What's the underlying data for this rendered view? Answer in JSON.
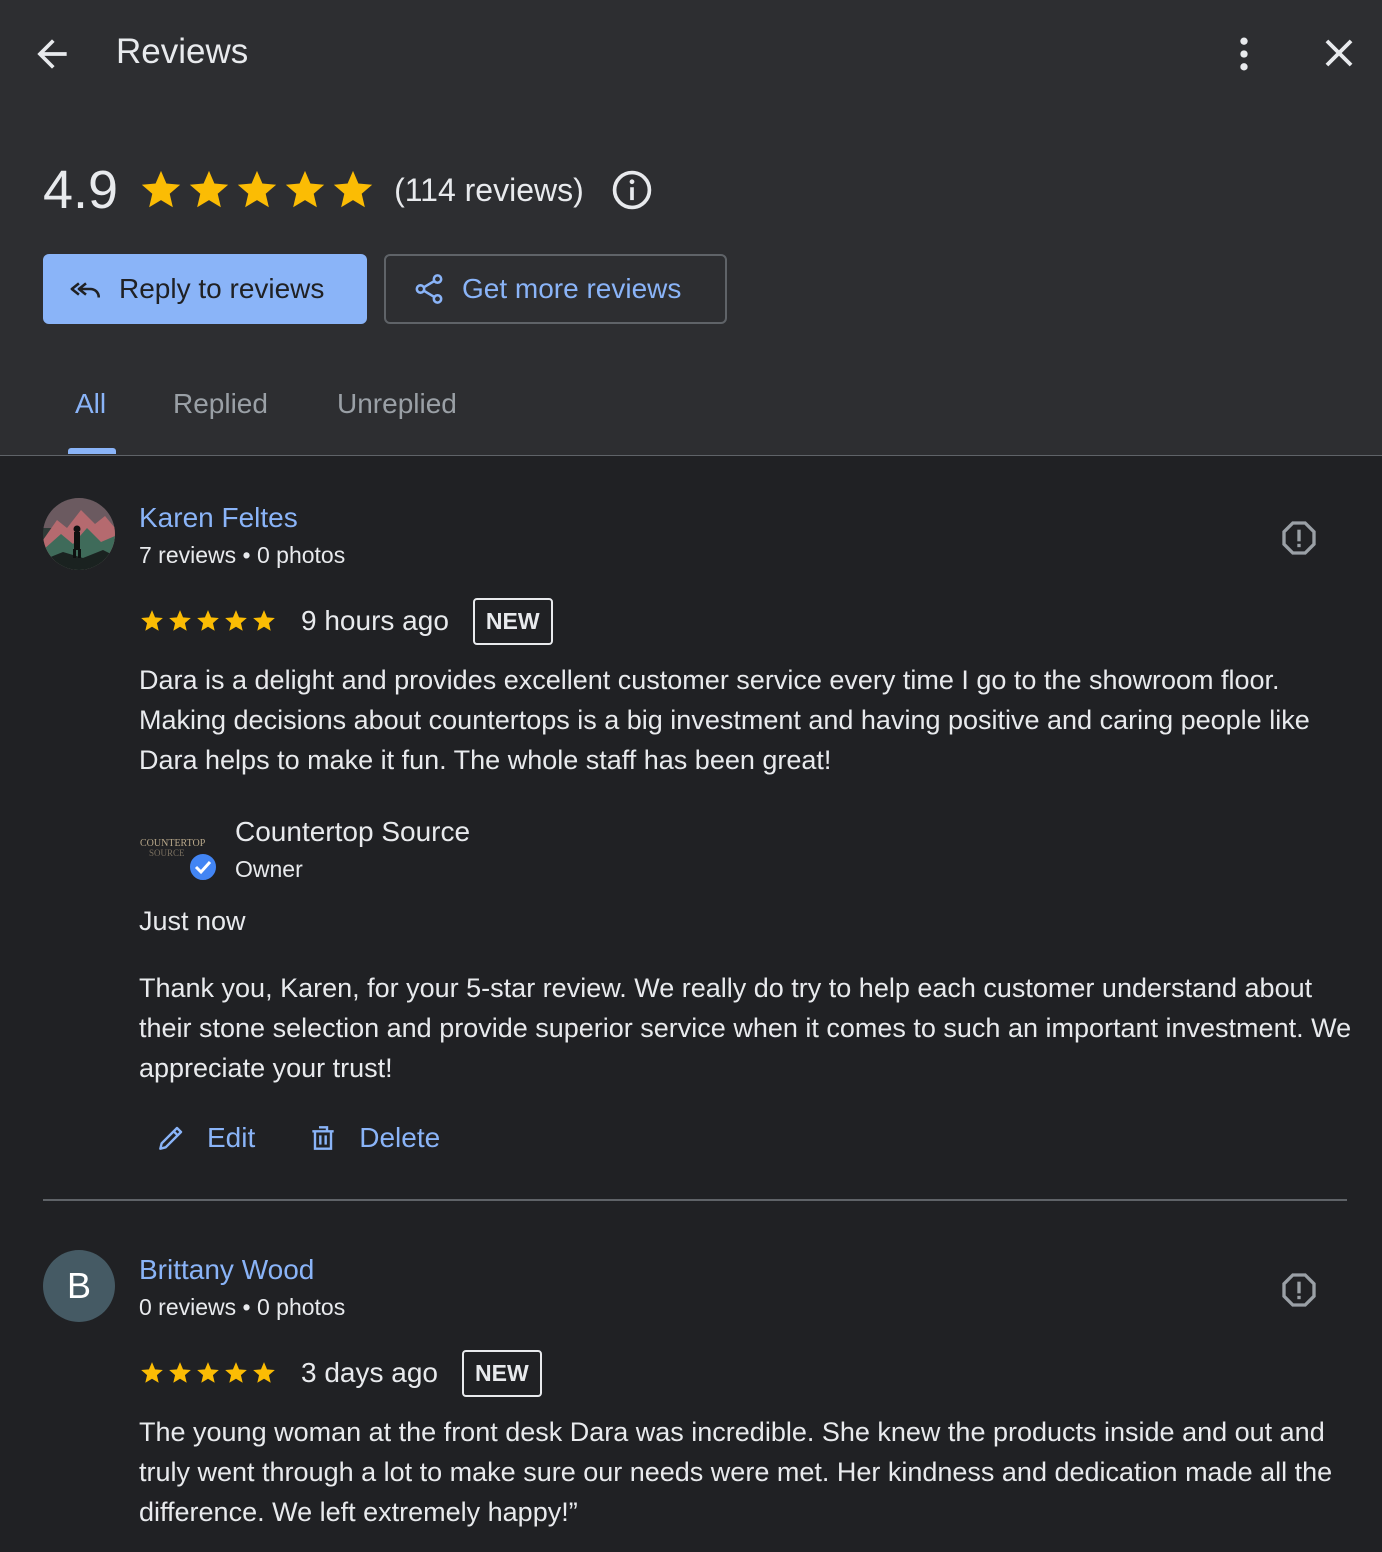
{
  "header": {
    "title": "Reviews",
    "back_icon": "arrow-left-icon",
    "more_icon": "more-vert-icon",
    "close_icon": "close-icon"
  },
  "summary": {
    "rating": "4.9",
    "stars": 5,
    "count_text": "(114 reviews)",
    "info_icon": "info-icon"
  },
  "actions": {
    "reply_label": "Reply to reviews",
    "get_more_label": "Get more reviews"
  },
  "tabs": [
    {
      "label": "All",
      "active": true
    },
    {
      "label": "Replied",
      "active": false
    },
    {
      "label": "Unreplied",
      "active": false
    }
  ],
  "reviews": [
    {
      "author": "Karen Feltes",
      "meta": "7 reviews • 0 photos",
      "stars": 5,
      "time": "9 hours ago",
      "badge": "NEW",
      "text": "Dara is a delight and provides excellent customer service every time I go to the showroom floor. Making decisions about countertops is a big investment and having positive and caring people like Dara helps to make it fun. The whole staff has been great!",
      "reply": {
        "owner_name": "Countertop Source",
        "owner_role": "Owner",
        "logo_text_1": "COUNTERTOP",
        "logo_text_2": "SOURCE",
        "time": "Just now",
        "text": "Thank you, Karen, for your 5-star review. We really do try to help each customer understand about their stone selection and provide superior service when it comes to such an important investment. We appreciate your trust!",
        "edit_label": "Edit",
        "delete_label": "Delete"
      }
    },
    {
      "author": "Brittany Wood",
      "avatar_letter": "B",
      "meta": "0 reviews • 0 photos",
      "stars": 5,
      "time": "3 days ago",
      "badge": "NEW",
      "text": "The young woman at the front desk Dara was incredible. She knew the products inside and out and truly went through a lot to make sure our needs were met. Her kindness and dedication made all the difference. We left extremely happy!”"
    }
  ],
  "colors": {
    "accent": "#8ab4f8",
    "star": "#fbbc04",
    "header_bg": "#2d2e31",
    "body_bg": "#202124"
  }
}
